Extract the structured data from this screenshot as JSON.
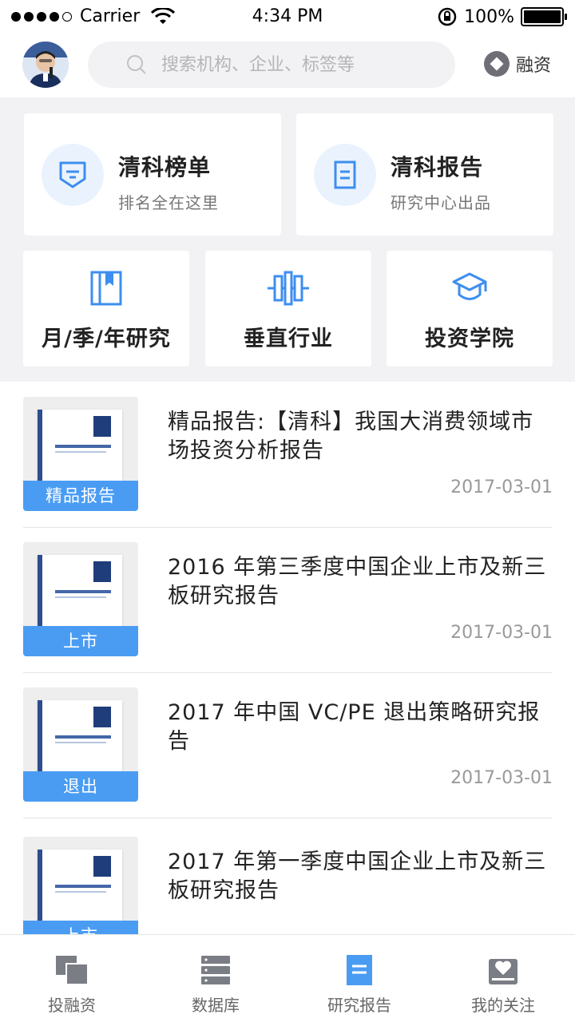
{
  "status_bar": {
    "carrier": "Carrier",
    "time": "4:34 PM",
    "battery": "100%",
    "battery_level": 1.0,
    "signal_bars": 4
  },
  "header": {
    "search_placeholder": "搜索机构、企业、标签等",
    "finance_label": "融资"
  },
  "feature_cards": [
    {
      "title": "清科榜单",
      "subtitle": "排名全在这里",
      "icon": "ranking-badge-icon"
    },
    {
      "title": "清科报告",
      "subtitle": "研究中心出品",
      "icon": "report-document-icon"
    }
  ],
  "category_cards": [
    {
      "label": "月/季/年研究",
      "icon": "bookmark-book-icon"
    },
    {
      "label": "垂直行业",
      "icon": "industry-bars-icon"
    },
    {
      "label": "投资学院",
      "icon": "graduation-cap-icon"
    }
  ],
  "reports": [
    {
      "title": "精品报告:【清科】我国大消费领域市场投资分析报告",
      "tag": "精品报告",
      "date": "2017-03-01"
    },
    {
      "title": "2016 年第三季度中国企业上市及新三板研究报告",
      "tag": "上市",
      "date": "2017-03-01"
    },
    {
      "title": "2017 年中国 VC/PE 退出策略研究报告",
      "tag": "退出",
      "date": "2017-03-01"
    },
    {
      "title": "2017 年第一季度中国企业上市及新三板研究报告",
      "tag": "上市",
      "date": ""
    }
  ],
  "tabs": [
    {
      "label": "投融资",
      "icon": "investment-icon",
      "active": false
    },
    {
      "label": "数据库",
      "icon": "database-icon",
      "active": false
    },
    {
      "label": "研究报告",
      "icon": "research-report-icon",
      "active": true
    },
    {
      "label": "我的关注",
      "icon": "heart-follow-icon",
      "active": false
    }
  ],
  "colors": {
    "accent": "#4a9cf3",
    "icon_blue": "#3d8ef0",
    "background_gray": "#f2f2f4",
    "text_dark": "#222222",
    "text_muted": "#999999",
    "tab_gray": "#7b7d85"
  }
}
